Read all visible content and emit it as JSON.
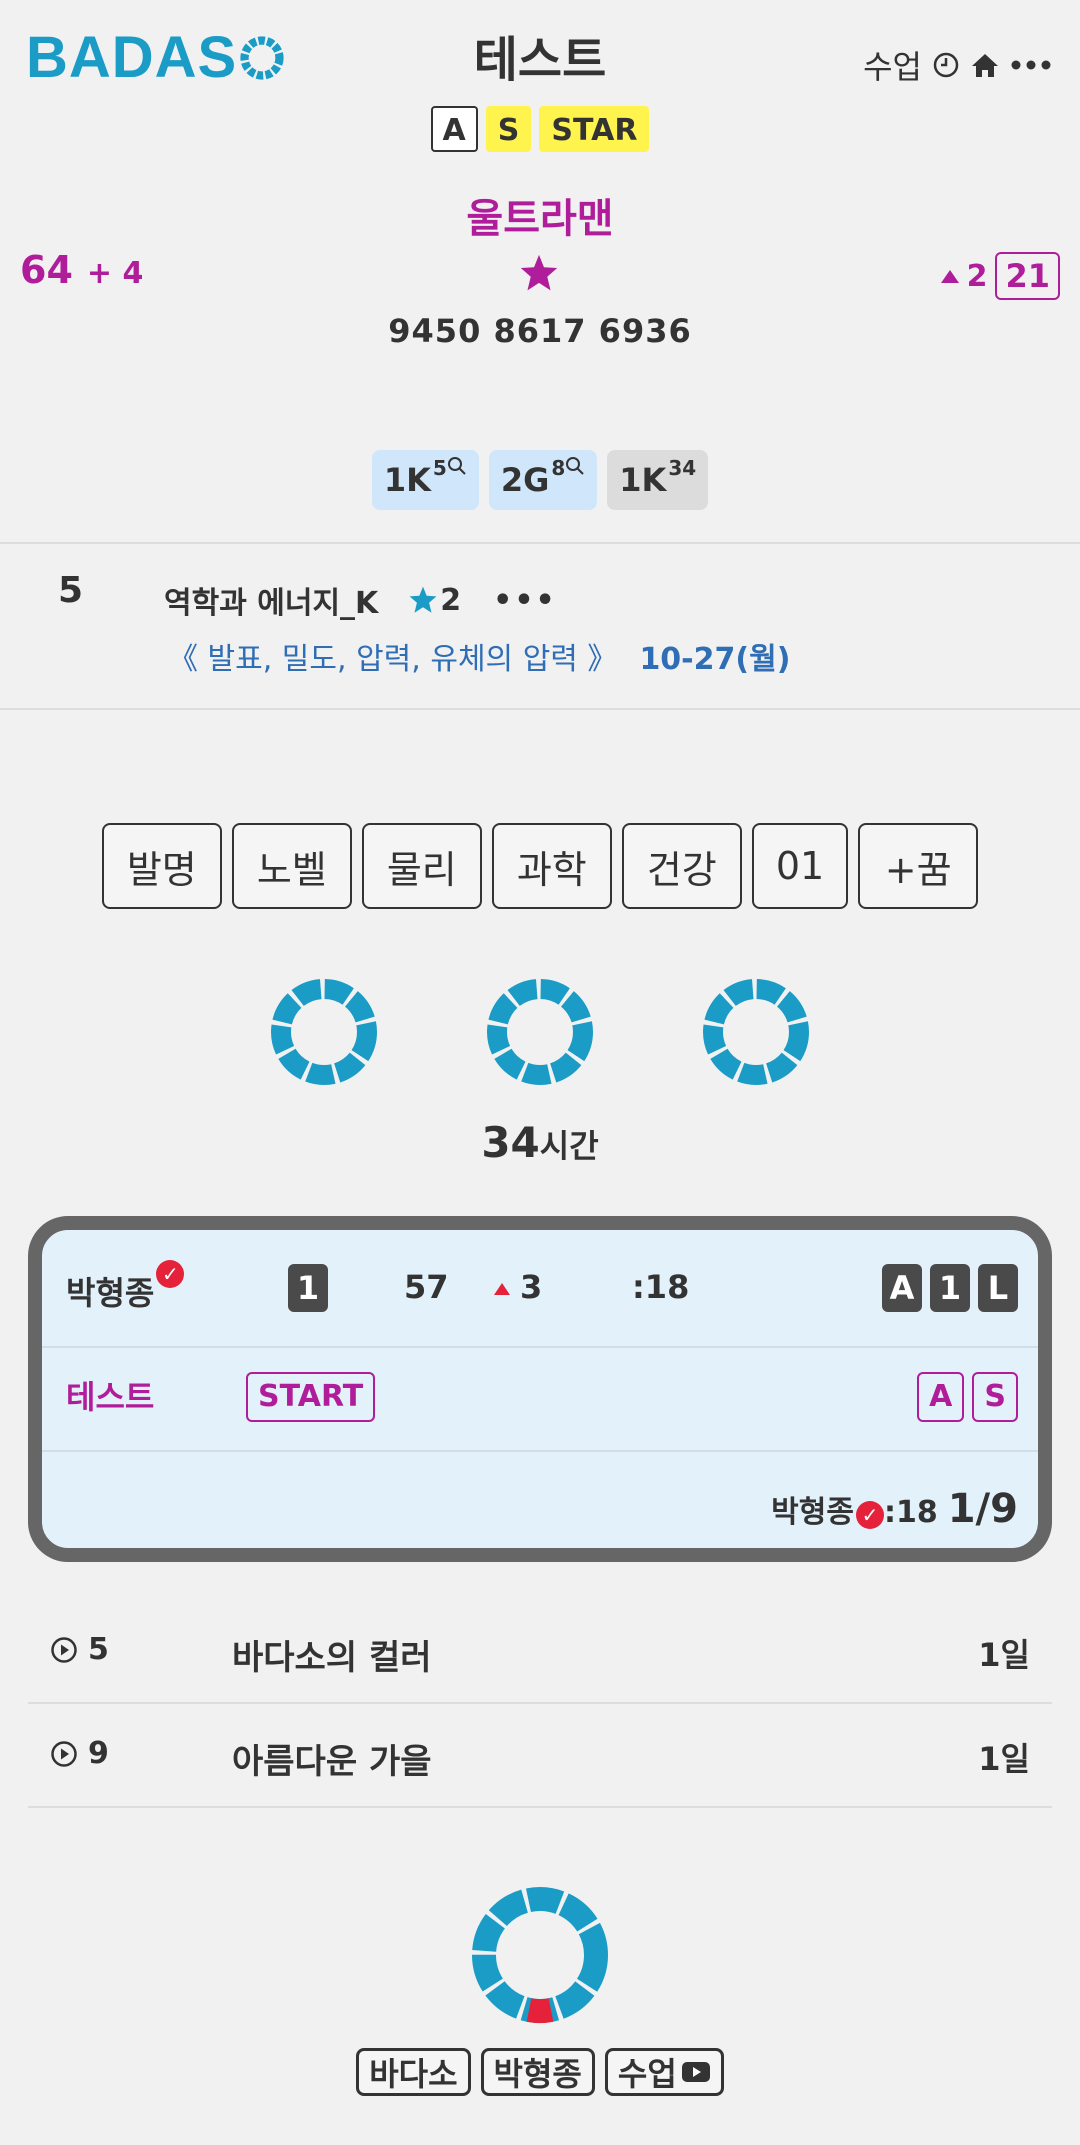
{
  "header": {
    "logo_text": "BADAS",
    "title": "테스트",
    "class_label": "수업",
    "clock_icon": "clock-icon",
    "home_icon": "home-icon",
    "more_icon": "more-horizontal-icon"
  },
  "tags": [
    "A",
    "S",
    "STAR"
  ],
  "profile": {
    "name": "울트라맨",
    "score": "64",
    "score_delta": "+ 4",
    "rank_up": "2",
    "rank": "21",
    "numbers": "9450 8617 6936"
  },
  "levels": [
    {
      "main": "1K",
      "sup": "5",
      "icon": "search-icon"
    },
    {
      "main": "2G",
      "sup": "8",
      "icon": "search-icon"
    },
    {
      "main": "1K",
      "sup": "34"
    }
  ],
  "lesson": {
    "number": "5",
    "title": "역학과 에너지_K",
    "stars": "2",
    "more": "•••",
    "subtitle": "《 발표, 밀도, 압력, 유체의 압력 》",
    "date": "10-27(월)"
  },
  "categories": [
    "발명",
    "노벨",
    "물리",
    "과학",
    "건강",
    "01",
    "+꿈"
  ],
  "hours": {
    "value": "34",
    "unit": "시간"
  },
  "card": {
    "player": "박형종",
    "badge_num": "1",
    "value": "57",
    "up": "3",
    "time": ":18",
    "right_badges": [
      "A",
      "1",
      "L"
    ],
    "test_label": "테스트",
    "start_label": "START",
    "grade_badges": [
      "A",
      "S"
    ],
    "footer_player": "박형종",
    "footer_time": ":18",
    "footer_progress": "1/9"
  },
  "list": [
    {
      "num": "5",
      "title": "바다소의 컬러",
      "days": "1일"
    },
    {
      "num": "9",
      "title": "아름다운 가을",
      "days": "1일"
    }
  ],
  "bottom_buttons": [
    "바다소",
    "박형종",
    "수업"
  ],
  "colors": {
    "brand": "#1a9cc7",
    "accent": "#b01d9a",
    "highlight": "#fff34d",
    "alert": "#e5223a"
  }
}
